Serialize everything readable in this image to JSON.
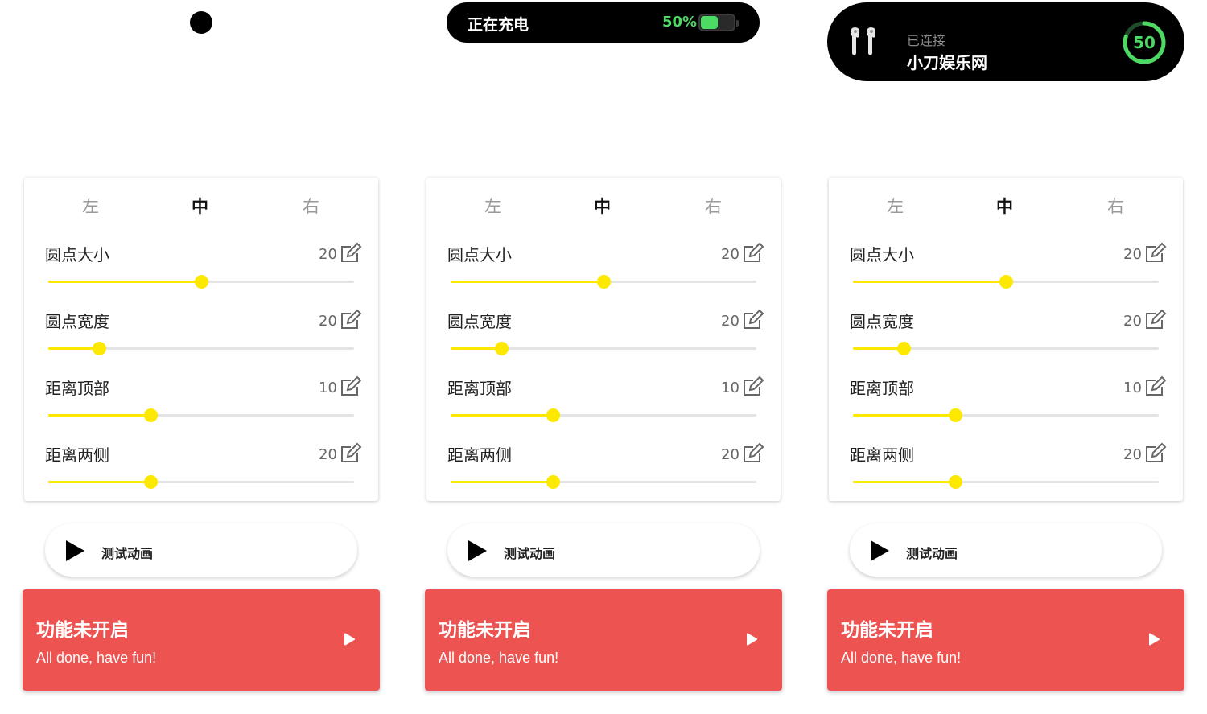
{
  "islands": {
    "charging": {
      "text": "正在充电",
      "percent_label": "50%",
      "battery_level": 0.5,
      "accent": "#4cd964"
    },
    "connected": {
      "status": "已连接",
      "device": "小刀娱乐网",
      "ring_value": "50",
      "ring_level": 0.8,
      "accent": "#4cd964"
    }
  },
  "panel": {
    "tabs": [
      "左",
      "中",
      "右"
    ],
    "active_tab": 1,
    "settings": [
      {
        "label": "圆点大小",
        "value": "20",
        "slider_fraction": 0.5
      },
      {
        "label": "圆点宽度",
        "value": "20",
        "slider_fraction": 0.167
      },
      {
        "label": "距离顶部",
        "value": "10",
        "slider_fraction": 0.333
      },
      {
        "label": "距离两侧",
        "value": "20",
        "slider_fraction": 0.333
      }
    ],
    "slider_color": "#fde800"
  },
  "test_button": {
    "label": "测试动画"
  },
  "status_card": {
    "title": "功能未开启",
    "subtitle": "All done, have fun!",
    "color": "#ed5350"
  },
  "icons": {
    "edit": "edit-icon",
    "play": "play-icon",
    "arrow": "arrow-right-icon",
    "earbuds": "earbuds-icon"
  }
}
